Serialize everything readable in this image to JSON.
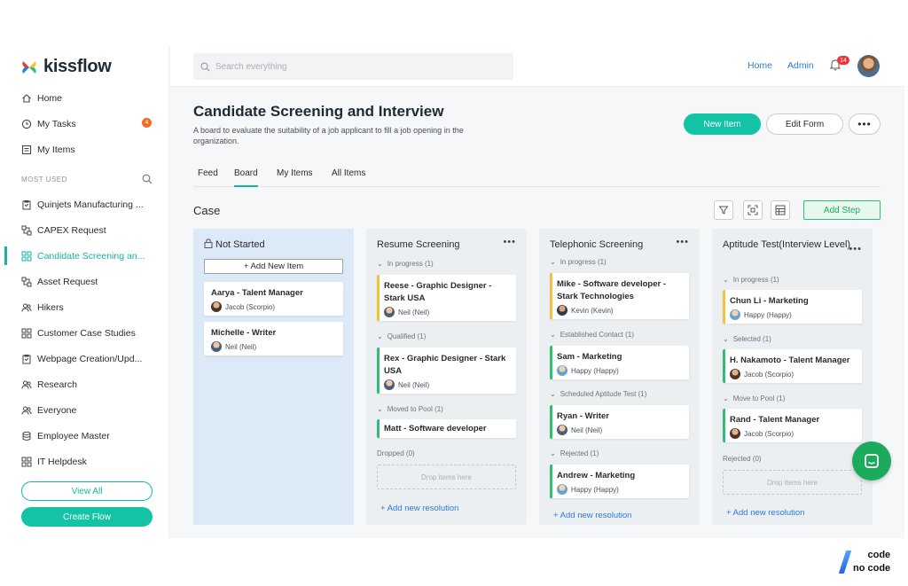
{
  "brand": {
    "name": "kissflow"
  },
  "sidebar": {
    "items": [
      {
        "label": "Home",
        "icon": "home-icon"
      },
      {
        "label": "My Tasks",
        "icon": "clock-icon",
        "badge": "4"
      },
      {
        "label": "My Items",
        "icon": "list-icon"
      }
    ],
    "section_label": "MOST USED",
    "used": [
      {
        "label": "Quinjets Manufacturing ...",
        "icon": "clipboard-icon"
      },
      {
        "label": "CAPEX Request",
        "icon": "flow-icon"
      },
      {
        "label": "Candidate Screening an...",
        "icon": "board-icon",
        "active": true
      },
      {
        "label": "Asset Request",
        "icon": "flow-icon"
      },
      {
        "label": "Hikers",
        "icon": "people-icon"
      },
      {
        "label": "Customer Case Studies",
        "icon": "board-icon"
      },
      {
        "label": "Webpage Creation/Upd...",
        "icon": "clipboard-icon"
      },
      {
        "label": "Research",
        "icon": "people-icon"
      },
      {
        "label": "Everyone",
        "icon": "people-icon"
      },
      {
        "label": "Employee Master",
        "icon": "database-icon"
      },
      {
        "label": "IT Helpdesk",
        "icon": "board-icon"
      }
    ],
    "view_all": "View All",
    "create_flow": "Create Flow"
  },
  "topbar": {
    "search_placeholder": "Search everything",
    "links": [
      "Home",
      "Admin"
    ],
    "notification_count": "14"
  },
  "page": {
    "title": "Candidate Screening and Interview",
    "description": "A board to evaluate the suitability of a job applicant to fill a job opening in the organization.",
    "new_item": "New Item",
    "edit_form": "Edit Form",
    "more": "•••",
    "tabs": [
      "Feed",
      "Board",
      "My Items",
      "All Items"
    ],
    "active_tab": "Board"
  },
  "board": {
    "case_title": "Case",
    "add_step": "Add Step",
    "columns": [
      {
        "title": "Not Started",
        "add_item": "+ Add New Item",
        "cards": [
          {
            "title": "Aarya - Talent Manager",
            "user": "Jacob (Scorpio)"
          },
          {
            "title": "Michelle - Writer",
            "user": "Neil (Neil)"
          }
        ]
      },
      {
        "title": "Resume Screening",
        "groups": [
          {
            "label": "In progress  (1)",
            "cards": [
              {
                "title": "Reese - Graphic Designer - Stark USA",
                "user": "Neil (Neil)"
              }
            ]
          },
          {
            "label": "Qualified  (1)",
            "cards": [
              {
                "title": "Rex - Graphic Designer - Stark USA",
                "user": "Neil (Neil)"
              }
            ]
          },
          {
            "label": "Moved to Pool  (1)",
            "cards": [
              {
                "title": "Matt - Software developer"
              }
            ]
          },
          {
            "label": "Dropped  (0)"
          }
        ],
        "drop_text": "Drop items here",
        "add_resolution": "+ Add new resolution"
      },
      {
        "title": "Telephonic Screening",
        "groups": [
          {
            "label": "In progress  (1)",
            "cards": [
              {
                "title": "Mike - Software developer - Stark Technologies",
                "user": "Kevin (Kevin)"
              }
            ]
          },
          {
            "label": "Established Contact  (1)",
            "cards": [
              {
                "title": "Sam - Marketing",
                "user": "Happy (Happy)"
              }
            ]
          },
          {
            "label": "Scheduled Aptitude Test  (1)",
            "cards": [
              {
                "title": "Ryan - Writer",
                "user": "Neil (Neil)"
              }
            ]
          },
          {
            "label": "Rejected  (1)",
            "cards": [
              {
                "title": "Andrew - Marketing",
                "user": "Happy (Happy)"
              }
            ]
          }
        ],
        "add_resolution": "+ Add new resolution"
      },
      {
        "title": "Aptitude Test(Interview Level)",
        "groups": [
          {
            "label": "In progress  (1)",
            "cards": [
              {
                "title": "Chun Li - Marketing",
                "user": "Happy (Happy)"
              }
            ]
          },
          {
            "label": "Selected  (1)",
            "cards": [
              {
                "title": "H. Nakamoto - Talent Manager",
                "user": "Jacob (Scorpio)"
              }
            ]
          },
          {
            "label": "Move to Pool  (1)",
            "cards": [
              {
                "title": "Rand - Talent Manager",
                "user": "Jacob (Scorpio)"
              }
            ]
          },
          {
            "label": "Rejected  (0)"
          }
        ],
        "drop_text": "Drop items here",
        "add_resolution": "+ Add new resolution"
      }
    ]
  },
  "watermark": {
    "line1": "code",
    "line2": "no code"
  },
  "colors": {
    "accent": "#13c3a6",
    "link": "#2a7bd8",
    "in_progress": "#f4c13a",
    "resolved": "#2ebf73",
    "badge": "#f26b21"
  }
}
